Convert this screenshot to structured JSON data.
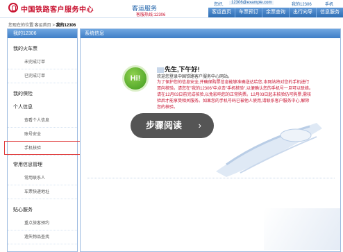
{
  "header": {
    "brand": "中国铁路客户服务中心",
    "brand_sub": "客运服务",
    "hotline": "客服热线:12306",
    "top_user": "您好,",
    "top_email": "12306@example.com",
    "top_right": "我的12306",
    "top_right2": "手机",
    "nav": [
      "客运首页",
      "车票预订",
      "余票查询",
      "出行向导",
      "信息服务"
    ]
  },
  "breadcrumb": {
    "prefix": "您现在的位置:",
    "home": "客运首页",
    "sep": " > ",
    "current": "我的12306"
  },
  "sidebar": {
    "title": "我的12306",
    "groups": [
      {
        "label": "我的火车票",
        "items": [
          "未完成订单",
          "已完成订单"
        ]
      },
      {
        "label": "我的保险",
        "items": []
      },
      {
        "label": "个人信息",
        "items": [
          "查看个人信息",
          "账号安全",
          "手机核验"
        ]
      },
      {
        "label": "常用信息管理",
        "items": [
          "常用联系人",
          "车票快递地址"
        ]
      },
      {
        "label": "贴心服务",
        "items": [
          "重点旅客预约",
          "遗失物品查找"
        ]
      }
    ]
  },
  "main": {
    "title": "系统信息",
    "badge": "Hi!",
    "greeting": "先生,下午好!",
    "welcome": "欢迎您登录中国铁路客户服务中心网站。",
    "notice": "为了保护您的信息安全,并确保购票信息能够准确送达给您,本网站将对您的手机进行双向核验。请您在\"我的12306\"中点击\"手机核验\",以便确认您的手机号一旦可以联络。请在12月03日前完成核验,以免影响您的正常购票。12月03日起未核验仍可购票,需核验后才能享受相关服务。如果您的手机号码已被他人使用,请联系客户服务中心,解除您的核验。"
  },
  "overlay": {
    "label": "步骤阅读",
    "chevron": "›"
  },
  "colors": {
    "brand_red": "#c8102e",
    "nav_blue": "#2e6db4",
    "highlight_red": "#e03a3a"
  }
}
